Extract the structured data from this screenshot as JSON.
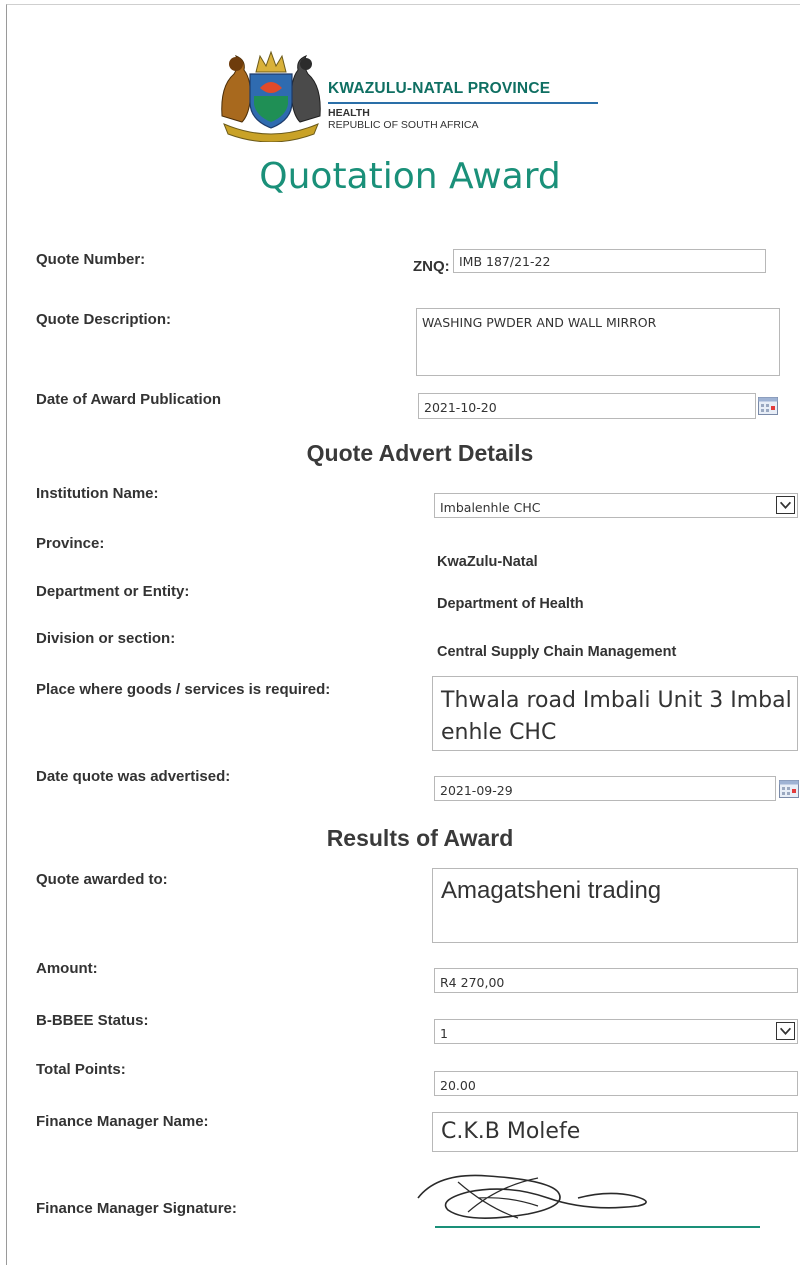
{
  "header": {
    "province": "KWAZULU-NATAL PROVINCE",
    "dept": "HEALTH",
    "country": "REPUBLIC OF SOUTH AFRICA"
  },
  "title": "Quotation Award",
  "quote": {
    "number_label": "Quote Number:",
    "prefix": "ZNQ:",
    "number": "IMB 187/21-22",
    "description_label": "Quote Description:",
    "description": "WASHING PWDER AND WALL MIRROR",
    "award_date_label": "Date of Award Publication",
    "award_date": "2021-10-20"
  },
  "advert": {
    "heading": "Quote Advert Details",
    "institution_label": "Institution Name:",
    "institution": "Imbalenhle CHC",
    "province_label": "Province:",
    "province": "KwaZulu-Natal",
    "department_label": "Department or Entity:",
    "department": "Department of Health",
    "division_label": "Division or section:",
    "division": "Central Supply Chain Management",
    "place_label": "Place where goods /  services is required:",
    "place_line1": "Thwala road Imbali Unit 3 Imbal",
    "place_line2": "enhle CHC",
    "advertised_label": "Date quote was advertised:",
    "advertised": "2021-09-29"
  },
  "results": {
    "heading": "Results of Award",
    "awarded_label": "Quote awarded to:",
    "awarded": "Amagatsheni trading",
    "amount_label": "Amount:",
    "amount": "R4 270,00",
    "bbbee_label": "B-BBEE Status:",
    "bbbee": "1",
    "points_label": "Total Points:",
    "points": "20.00",
    "fm_name_label": "Finance Manager Name:",
    "fm_name": "C.K.B Molefe",
    "fm_sig_label": "Finance Manager Signature:"
  },
  "colors": {
    "title": "#1a9079",
    "province_text": "#0f6f62",
    "rule": "#2a6fa8",
    "signature_line": "#1a9079"
  },
  "icons": {
    "calendar": "calendar-icon",
    "dropdown": "chevron-down-icon",
    "crest": "coat-of-arms-icon"
  }
}
